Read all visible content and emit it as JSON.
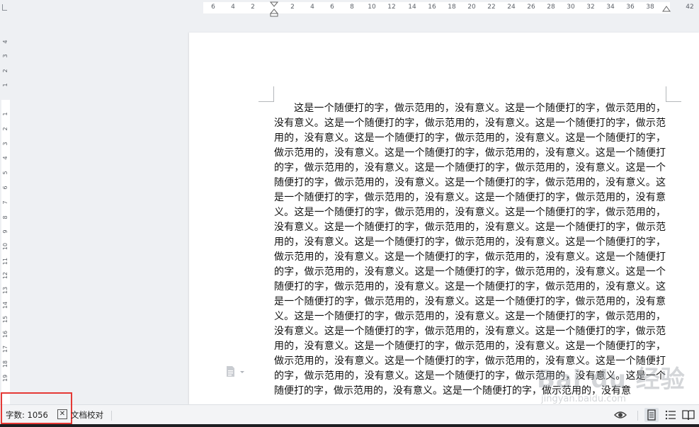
{
  "top_ruler": {
    "numbers": [
      "6",
      "4",
      "2",
      "2",
      "4",
      "6",
      "8",
      "10",
      "12",
      "14",
      "16",
      "18",
      "20",
      "22",
      "24",
      "26",
      "28",
      "30",
      "32",
      "34",
      "36",
      "38",
      "42"
    ]
  },
  "left_ruler": {
    "numbers": [
      "4",
      "3",
      "2",
      "1",
      "1",
      "2",
      "3",
      "4",
      "5",
      "6",
      "7",
      "8",
      "9",
      "10",
      "11",
      "12",
      "13",
      "14",
      "15",
      "16",
      "17",
      "18",
      "19"
    ]
  },
  "document": {
    "body_text": "这是一个随便打的字，做示范用的，没有意义。这是一个随便打的字，做示范用的，没有意义。这是一个随便打的字，做示范用的，没有意义。这是一个随便打的字，做示范用的，没有意义。这是一个随便打的字，做示范用的，没有意义。这是一个随便打的字，做示范用的，没有意义。这是一个随便打的字，做示范用的，没有意义。这是一个随便打的字，做示范用的，没有意义。这是一个随便打的字，做示范用的，没有意义。这是一个随便打的字，做示范用的，没有意义。这是一个随便打的字，做示范用的，没有意义。这是一个随便打的字，做示范用的，没有意义。这是一个随便打的字，做示范用的，没有意义。这是一个随便打的字，做示范用的，没有意义。这是一个随便打的字，做示范用的，没有意义。这是一个随便打的字，做示范用的，没有意义。这是一个随便打的字，做示范用的，没有意义。这是一个随便打的字，做示范用的，没有意义。这是一个随便打的字，做示范用的，没有意义。这是一个随便打的字，做示范用的，没有意义。这是一个随便打的字，做示范用的，没有意义。这是一个随便打的字，做示范用的，没有意义。这是一个随便打的字，做示范用的，没有意义。这是一个随便打的字，做示范用的，没有意义。这是一个随便打的字，做示范用的，没有意义。这是一个随便打的字，做示范用的，没有意义。这是一个随便打的字，做示范用的，没有意义。这是一个随便打的字，做示范用的，没有意义。这是一个随便打的字，做示范用的，没有意义。这是一个随便打的字，做示范用的，没有意义。这是一个随便打的字，做示范用的，没有意义。这是一个随便打的字，做示范用的，没有意义。这是一个随便打的字，做示范用的，没有意义。这是一个随便打的字，做示范用的，没有意义。这是一个随便打的字，做示范用的，没有意义。这是一个随便打的字，做示范用的，没有意义。这是一个随便打的字，做示范用的，没有意"
  },
  "status_bar": {
    "word_count_label": "字数: 1056",
    "proofread_label": "文档校对",
    "proofread_toggle_glyph": "✕"
  },
  "icons": {
    "doc": "doc-icon",
    "reading_mode": "eye-icon",
    "page_view": "page-view-icon",
    "outline_view": "outline-list-icon",
    "read_view": "book-icon"
  },
  "watermark": {
    "logo": "Bai du 经验",
    "url": "jingyan.baidu.com"
  },
  "colors": {
    "highlight_box": "#e53935",
    "page_bg": "#ffffff",
    "workspace_bg": "#eef0f3"
  }
}
